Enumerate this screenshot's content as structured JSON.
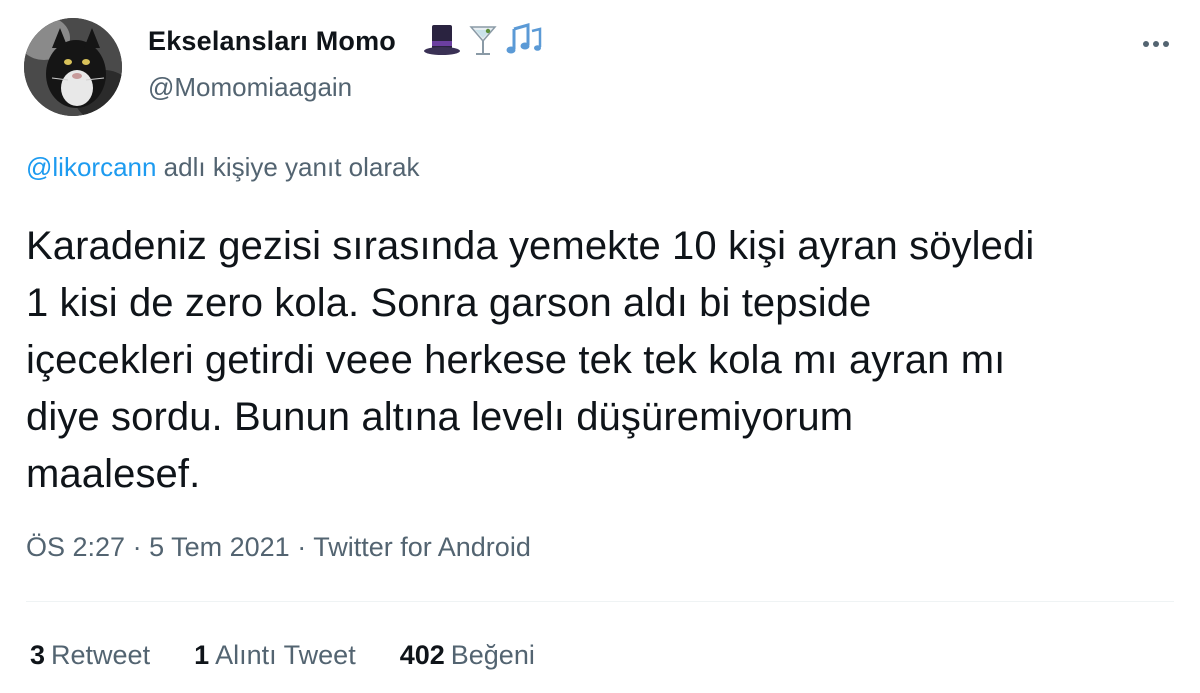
{
  "user": {
    "display_name": "Ekselansları Momo",
    "display_emojis": [
      "top-hat",
      "cocktail-glass",
      "music-notes"
    ],
    "handle": "@Momomiaagain"
  },
  "reply": {
    "mention": "@likorcann",
    "suffix": " adlı kişiye yanıt olarak"
  },
  "tweet": {
    "lines": [
      "Karadeniz gezisi sırasında yemekte 10 kişi ayran söyledi",
      "1 kisi de zero kola. Sonra garson aldı bi tepside",
      "içecekleri getirdi veee herkese tek tek kola mı ayran mı",
      "diye sordu. Bunun altına levelı düşüremiyorum",
      "maalesef."
    ]
  },
  "meta": {
    "time": "ÖS 2:27",
    "date": "5 Tem 2021",
    "separator": "·",
    "source": "Twitter for Android"
  },
  "stats": {
    "retweets": {
      "count": "3",
      "label": "Retweet"
    },
    "quotes": {
      "count": "1",
      "label": "Alıntı Tweet"
    },
    "likes": {
      "count": "402",
      "label": "Beğeni"
    }
  },
  "colors": {
    "link": "#1d9bf0",
    "secondary_text": "#536471",
    "primary_text": "#0f1419",
    "divider": "#eff3f4"
  }
}
